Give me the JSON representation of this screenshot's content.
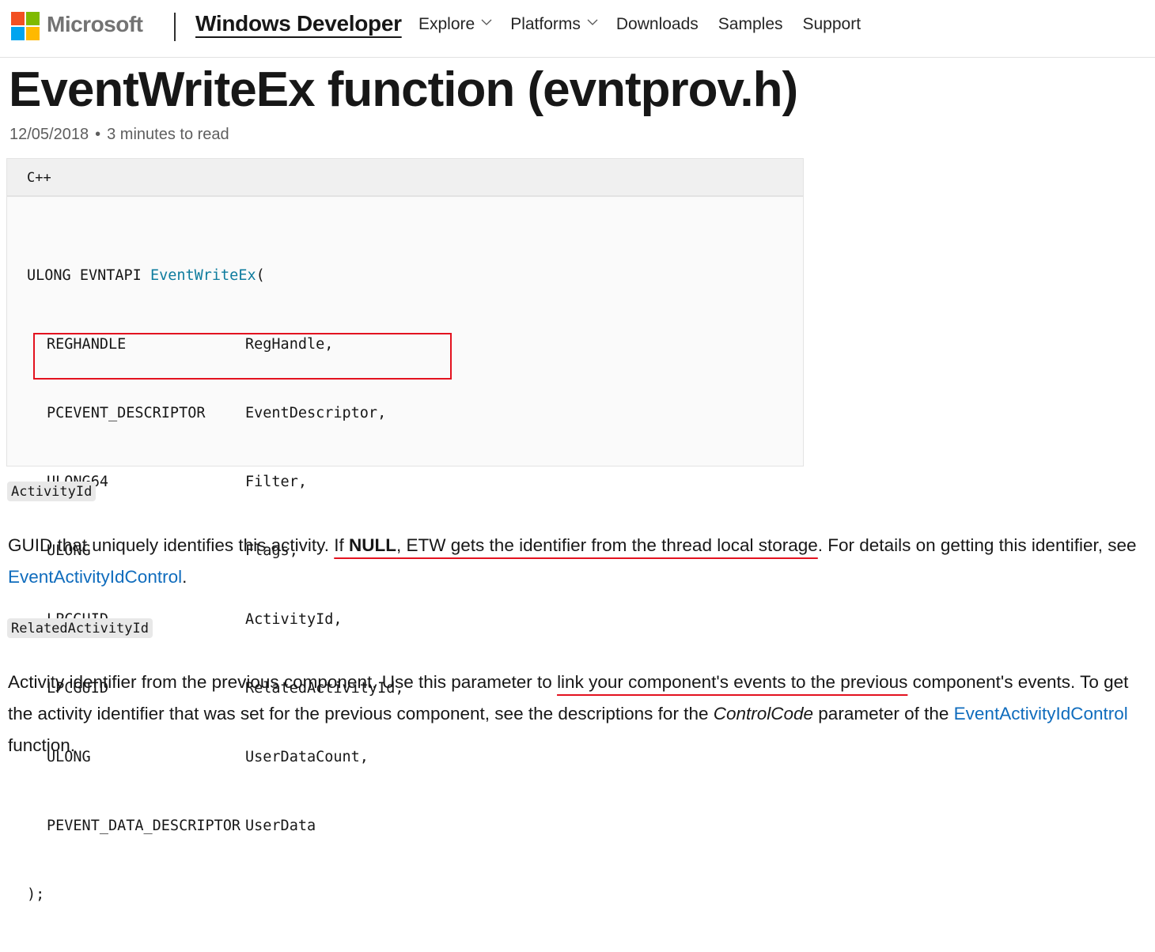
{
  "header": {
    "brand": "Microsoft",
    "logo_colors": [
      "#f25022",
      "#7fba00",
      "#00a4ef",
      "#ffb900"
    ],
    "site_title": "Windows Developer",
    "nav": [
      {
        "label": "Explore",
        "has_dropdown": true
      },
      {
        "label": "Platforms",
        "has_dropdown": true
      },
      {
        "label": "Downloads",
        "has_dropdown": false
      },
      {
        "label": "Samples",
        "has_dropdown": false
      },
      {
        "label": "Support",
        "has_dropdown": false
      }
    ]
  },
  "article": {
    "title": "EventWriteEx function (evntprov.h)",
    "date": "12/05/2018",
    "separator": "•",
    "read_time": "3 minutes to read"
  },
  "code": {
    "language": "C++",
    "signature": {
      "return_type": "ULONG EVNTAPI ",
      "function_name": "EventWriteEx",
      "open": "("
    },
    "params": [
      {
        "type": "REGHANDLE",
        "name": "RegHandle,"
      },
      {
        "type": "PCEVENT_DESCRIPTOR",
        "name": "EventDescriptor,"
      },
      {
        "type": "ULONG64",
        "name": "Filter,"
      },
      {
        "type": "ULONG",
        "name": "Flags,"
      },
      {
        "type": "LPCGUID",
        "name": "ActivityId,"
      },
      {
        "type": "LPCGUID",
        "name": "RelatedActivityId,"
      },
      {
        "type": "ULONG",
        "name": "UserDataCount,"
      },
      {
        "type": "PEVENT_DATA_DESCRIPTOR",
        "name": "UserData"
      }
    ],
    "close": ");",
    "highlight_color": "#e3121f",
    "function_color": "#0e7c9e"
  },
  "sections": {
    "activity_id": {
      "chip": "ActivityId",
      "text_1": "GUID that uniquely identifies this activity. ",
      "marked_1": "If ",
      "marked_bold": "NULL",
      "marked_2": ", ETW gets the identifier from the thread local storage",
      "text_2": ". For details on getting this identifier, see ",
      "link": "EventActivityIdControl",
      "text_3": "."
    },
    "related_activity_id": {
      "chip": "RelatedActivityId",
      "text_1": "Activity identifier from the previous component. Use this parameter to ",
      "marked": "link your component's events to the previous",
      "text_2": " component's events. To get the activity identifier that was set for the previous component, see the descriptions for the ",
      "italic": "ControlCode",
      "text_3": " parameter of the ",
      "link": "EventActivityIdControl",
      "text_4": " function."
    }
  },
  "colors": {
    "link": "#0f6cbd",
    "annotation_red": "#e3121f"
  }
}
